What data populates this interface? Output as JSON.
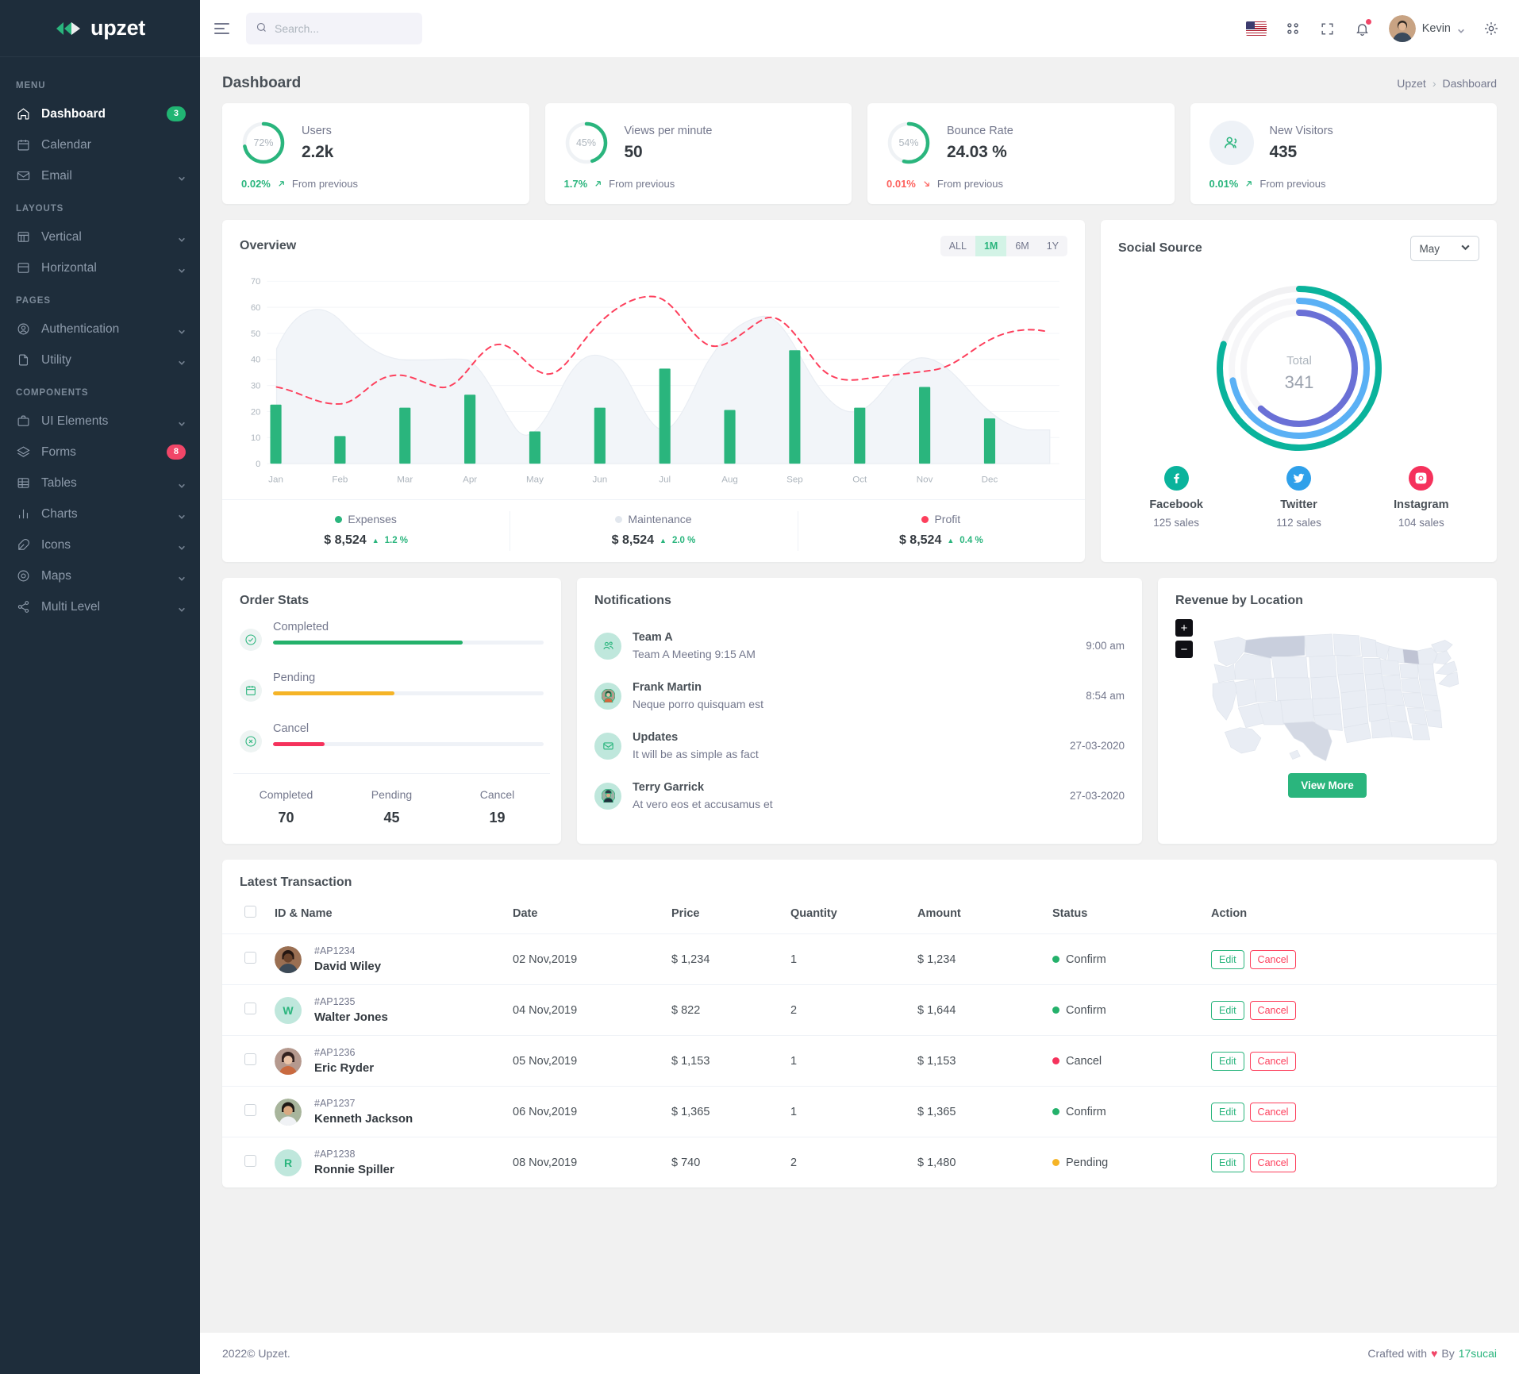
{
  "brand": {
    "name": "upzet"
  },
  "topbar": {
    "search_placeholder": "Search...",
    "user_name": "Kevin",
    "icons": [
      "flag-us-icon",
      "apps-grid-icon",
      "fullscreen-icon",
      "bell-icon",
      "gear-icon"
    ]
  },
  "page": {
    "title": "Dashboard",
    "breadcrumb_root": "Upzet",
    "breadcrumb_sep": "›",
    "breadcrumb_current": "Dashboard"
  },
  "sidebar": {
    "sections": [
      {
        "label": "MENU",
        "items": [
          {
            "label": "Dashboard",
            "icon": "home-icon",
            "badge": "3",
            "badge_color": "green",
            "active": true,
            "chevron": false
          },
          {
            "label": "Calendar",
            "icon": "calendar-icon",
            "chevron": false
          },
          {
            "label": "Email",
            "icon": "mail-icon",
            "chevron": true
          }
        ]
      },
      {
        "label": "LAYOUTS",
        "items": [
          {
            "label": "Vertical",
            "icon": "layout-vertical-icon",
            "chevron": true
          },
          {
            "label": "Horizontal",
            "icon": "layout-horizontal-icon",
            "chevron": true
          }
        ]
      },
      {
        "label": "PAGES",
        "items": [
          {
            "label": "Authentication",
            "icon": "user-circle-icon",
            "chevron": true
          },
          {
            "label": "Utility",
            "icon": "file-icon",
            "chevron": true
          }
        ]
      },
      {
        "label": "COMPONENTS",
        "items": [
          {
            "label": "UI Elements",
            "icon": "briefcase-icon",
            "chevron": true
          },
          {
            "label": "Forms",
            "icon": "layers-icon",
            "badge": "8",
            "badge_color": "red",
            "chevron": false
          },
          {
            "label": "Tables",
            "icon": "table-icon",
            "chevron": true
          },
          {
            "label": "Charts",
            "icon": "bar-chart-icon",
            "chevron": true
          },
          {
            "label": "Icons",
            "icon": "feather-icon",
            "chevron": true
          },
          {
            "label": "Maps",
            "icon": "map-pin-icon",
            "chevron": true
          },
          {
            "label": "Multi Level",
            "icon": "share-icon",
            "chevron": true
          }
        ]
      }
    ]
  },
  "stats": [
    {
      "label": "Users",
      "value": "2.2k",
      "percent": 72,
      "percent_text": "72%",
      "delta": "0.02%",
      "direction": "up",
      "from": "From previous",
      "icon": "donut-chart"
    },
    {
      "label": "Views per minute",
      "value": "50",
      "percent": 45,
      "percent_text": "45%",
      "delta": "1.7%",
      "direction": "up",
      "from": "From previous",
      "icon": "donut-chart"
    },
    {
      "label": "Bounce Rate",
      "value": "24.03 %",
      "percent": 54,
      "percent_text": "54%",
      "delta": "0.01%",
      "direction": "down",
      "from": "From previous",
      "icon": "donut-chart"
    },
    {
      "label": "New Visitors",
      "value": "435",
      "percent": null,
      "percent_text": "",
      "delta": "0.01%",
      "direction": "up",
      "from": "From previous",
      "icon": "users-icon"
    }
  ],
  "overview": {
    "title": "Overview",
    "ranges": [
      {
        "label": "ALL",
        "active": false
      },
      {
        "label": "1M",
        "active": true
      },
      {
        "label": "6M",
        "active": false
      },
      {
        "label": "1Y",
        "active": false
      }
    ],
    "legend": [
      {
        "name": "Expenses",
        "value": "$ 8,524",
        "pct": "1.2 %",
        "color": "#2ab57d"
      },
      {
        "name": "Maintenance",
        "value": "$ 8,524",
        "pct": "2.0 %",
        "color": "#e9ecef"
      },
      {
        "name": "Profit",
        "value": "$ 8,524",
        "pct": "0.4 %",
        "color": "#fd3f5c"
      }
    ]
  },
  "chart_data": {
    "type": "bar",
    "title": "Overview",
    "xlabel": "",
    "ylabel": "",
    "ylim": [
      0,
      70
    ],
    "yticks": [
      0,
      10,
      20,
      30,
      40,
      50,
      60,
      70
    ],
    "grid": true,
    "legend_position": "bottom",
    "categories": [
      "Jan",
      "Feb",
      "Mar",
      "Apr",
      "May",
      "Jun",
      "Jul",
      "Aug",
      "Sep",
      "Oct",
      "Nov",
      "Dec"
    ],
    "series": [
      {
        "name": "Expenses",
        "type": "bar",
        "color": "#2ab57d",
        "values": [
          22.5,
          10.5,
          21.5,
          26.5,
          12.5,
          21.5,
          36.5,
          20.5,
          43.5,
          21.5,
          29.5,
          17.5
        ]
      },
      {
        "name": "Maintenance",
        "type": "area",
        "color": "#e9ecef",
        "values": [
          44,
          54,
          41,
          41.5,
          21.5,
          42.5,
          26.5,
          41,
          55.5,
          27,
          42.5,
          27
        ]
      },
      {
        "name": "Profit",
        "type": "line-dashed",
        "color": "#fd3f5c",
        "values": [
          29.5,
          24.5,
          35.5,
          29.5,
          44.5,
          34.5,
          64,
          51.5,
          59,
          35.5,
          38.5,
          51
        ]
      }
    ]
  },
  "social": {
    "title": "Social Source",
    "month": "May",
    "total_label": "Total",
    "total_value": "341",
    "rings": [
      {
        "name": "Facebook",
        "value": 125,
        "pct": 80,
        "color": "#0ab39c"
      },
      {
        "name": "Twitter",
        "value": 112,
        "pct": 72,
        "color": "#5ab0f5"
      },
      {
        "name": "Instagram",
        "value": 104,
        "pct": 62,
        "color": "#6a70d6"
      }
    ],
    "items": [
      {
        "name": "Facebook",
        "sales": "125 sales",
        "icon": "facebook-icon",
        "color": "#0ab39c"
      },
      {
        "name": "Twitter",
        "sales": "112 sales",
        "icon": "twitter-icon",
        "color": "#2fa0ea"
      },
      {
        "name": "Instagram",
        "sales": "104 sales",
        "icon": "instagram-icon",
        "color": "#f5325c"
      }
    ]
  },
  "order_stats": {
    "title": "Order Stats",
    "bars": [
      {
        "label": "Completed",
        "pct": 70,
        "color": "#24b16b",
        "icon": "check-circle-icon"
      },
      {
        "label": "Pending",
        "pct": 45,
        "color": "#f5b427",
        "icon": "calendar-icon"
      },
      {
        "label": "Cancel",
        "pct": 19,
        "color": "#f5325c",
        "icon": "x-circle-icon"
      }
    ],
    "summary": [
      {
        "label": "Completed",
        "value": "70"
      },
      {
        "label": "Pending",
        "value": "45"
      },
      {
        "label": "Cancel",
        "value": "19"
      }
    ]
  },
  "notifications": {
    "title": "Notifications",
    "items": [
      {
        "name": "Team A",
        "text": "Team A Meeting 9:15 AM",
        "time": "9:00 am",
        "avatar": "users-icon"
      },
      {
        "name": "Frank Martin",
        "text": "Neque porro quisquam est",
        "time": "8:54 am",
        "avatar": "photo"
      },
      {
        "name": "Updates",
        "text": "It will be as simple as fact",
        "time": "27-03-2020",
        "avatar": "mail-icon"
      },
      {
        "name": "Terry Garrick",
        "text": "At vero eos et accusamus et",
        "time": "27-03-2020",
        "avatar": "photo"
      }
    ]
  },
  "revenue_map": {
    "title": "Revenue by Location",
    "zoom_in": "+",
    "zoom_out": "−",
    "view_more": "View More"
  },
  "transactions": {
    "title": "Latest Transaction",
    "columns": [
      "ID & Name",
      "Date",
      "Price",
      "Quantity",
      "Amount",
      "Status",
      "Action"
    ],
    "edit_label": "Edit",
    "cancel_label": "Cancel",
    "rows": [
      {
        "id": "#AP1234",
        "name": "David Wiley",
        "date": "02 Nov,2019",
        "price": "$ 1,234",
        "qty": "1",
        "amount": "$ 1,234",
        "status": "Confirm",
        "status_color": "#24b16b",
        "avatar": "photo"
      },
      {
        "id": "#AP1235",
        "name": "Walter Jones",
        "date": "04 Nov,2019",
        "price": "$ 822",
        "qty": "2",
        "amount": "$ 1,644",
        "status": "Confirm",
        "status_color": "#24b16b",
        "avatar": "W"
      },
      {
        "id": "#AP1236",
        "name": "Eric Ryder",
        "date": "05 Nov,2019",
        "price": "$ 1,153",
        "qty": "1",
        "amount": "$ 1,153",
        "status": "Cancel",
        "status_color": "#f5325c",
        "avatar": "photo"
      },
      {
        "id": "#AP1237",
        "name": "Kenneth Jackson",
        "date": "06 Nov,2019",
        "price": "$ 1,365",
        "qty": "1",
        "amount": "$ 1,365",
        "status": "Confirm",
        "status_color": "#24b16b",
        "avatar": "photo"
      },
      {
        "id": "#AP1238",
        "name": "Ronnie Spiller",
        "date": "08 Nov,2019",
        "price": "$ 740",
        "qty": "2",
        "amount": "$ 1,480",
        "status": "Pending",
        "status_color": "#f5b427",
        "avatar": "R"
      }
    ]
  },
  "footer": {
    "left": "2022© Upzet.",
    "crafted": "Crafted with",
    "heart": "♥",
    "by": "By",
    "credit": "17sucai"
  }
}
